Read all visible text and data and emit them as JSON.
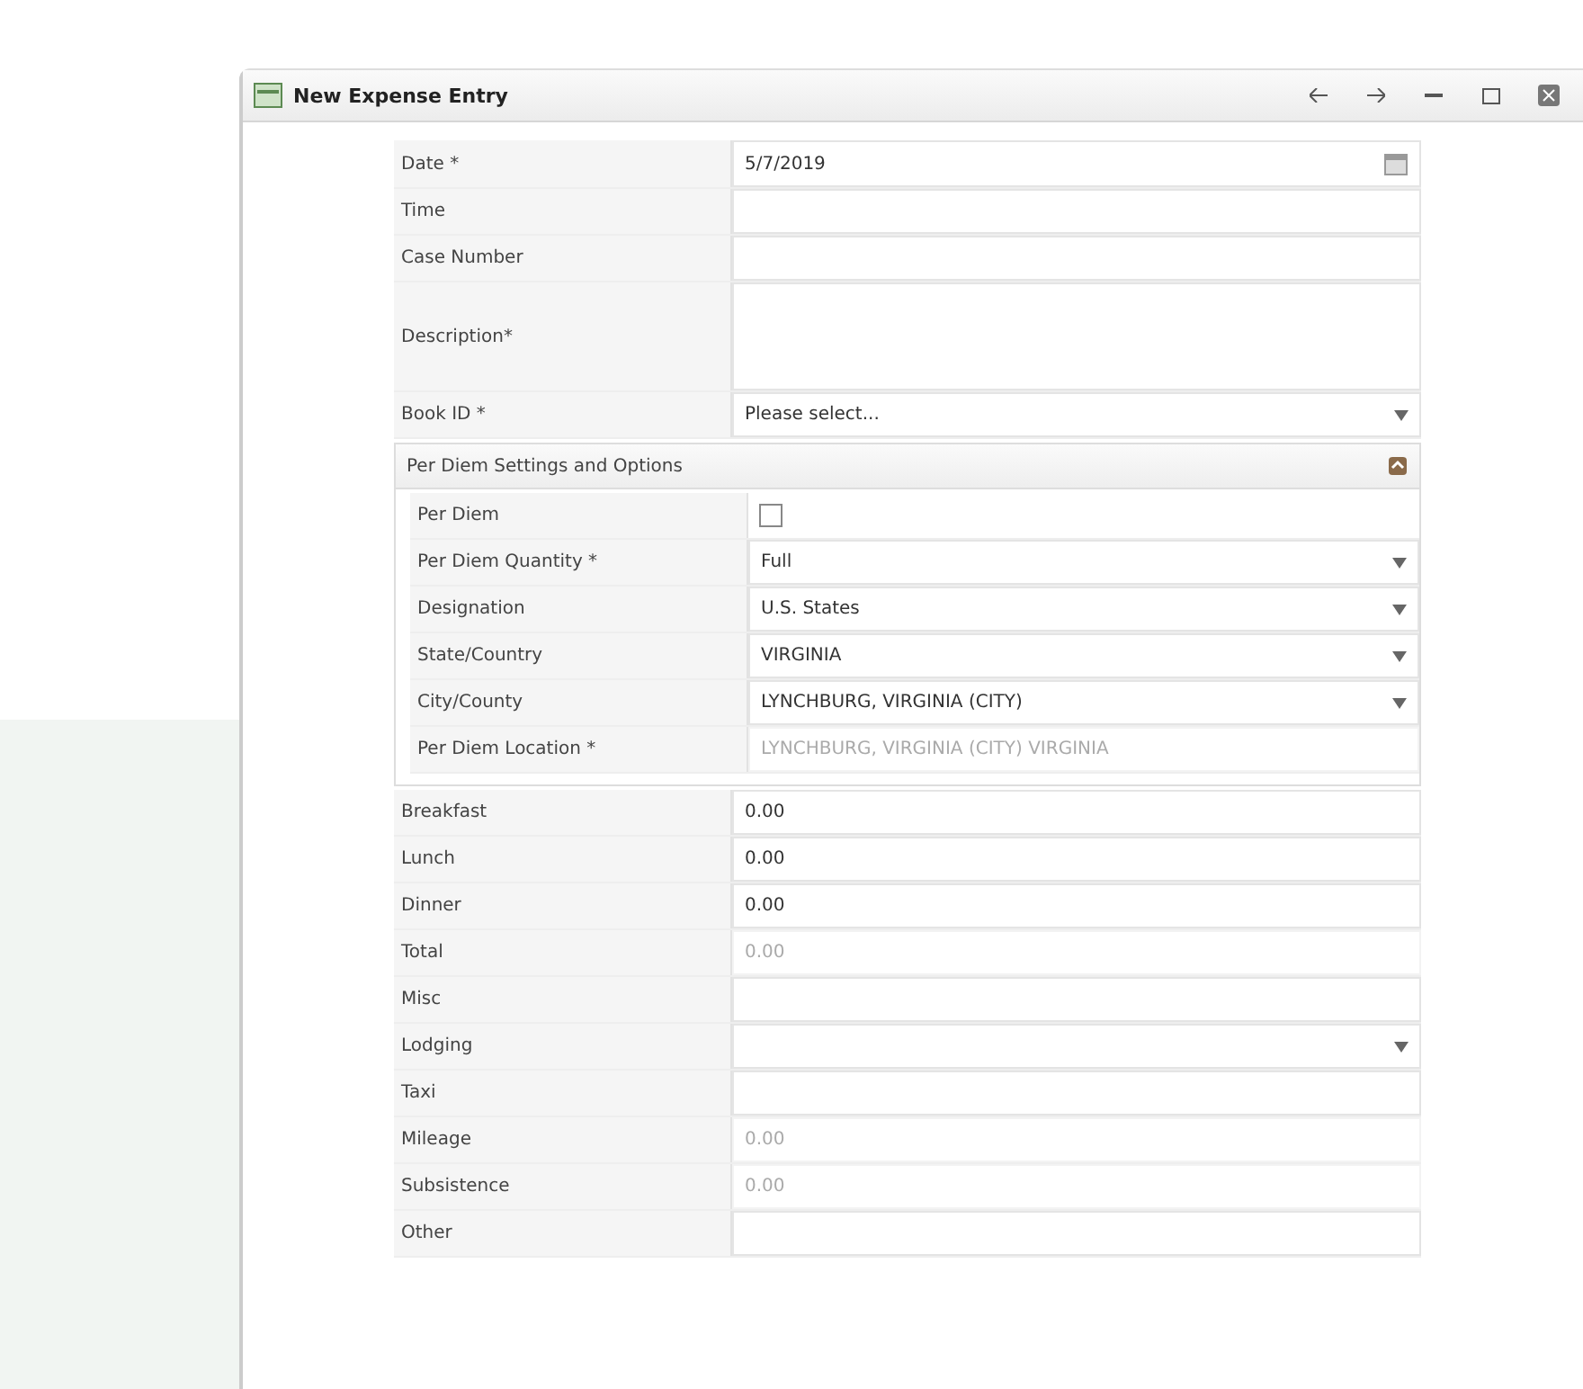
{
  "window": {
    "title": "New Expense Entry"
  },
  "fields": [
    {
      "kind": "date",
      "label": "Date *",
      "value": "5/7/2019"
    },
    {
      "kind": "text",
      "label": "Time"
    },
    {
      "kind": "text",
      "label": "Case Number"
    },
    {
      "kind": "textarea",
      "label": "Description*"
    },
    {
      "kind": "select",
      "label": "Book ID *",
      "value": "Please select..."
    },
    {
      "kind": "section",
      "label": "Per Diem Settings and Options",
      "children": [
        {
          "kind": "checkbox",
          "label": "Per Diem",
          "checked": false
        },
        {
          "kind": "select",
          "label": "Per Diem Quantity *",
          "value": "Full"
        },
        {
          "kind": "select",
          "label": "Designation",
          "value": "U.S. States"
        },
        {
          "kind": "select",
          "label": "State/Country",
          "value": "VIRGINIA"
        },
        {
          "kind": "select",
          "label": "City/County",
          "value": "LYNCHBURG, VIRGINIA (CITY)"
        },
        {
          "kind": "text",
          "label": "Per Diem Location *",
          "value": "LYNCHBURG, VIRGINIA (CITY) VIRGINIA",
          "disabled": true
        }
      ]
    },
    {
      "kind": "text",
      "label": "Breakfast",
      "value": "0.00",
      "disabled": false
    },
    {
      "kind": "text",
      "label": "Lunch",
      "value": "0.00",
      "disabled": false
    },
    {
      "kind": "text",
      "label": "Dinner",
      "value": "0.00",
      "disabled": false
    },
    {
      "kind": "text",
      "label": "Total",
      "value": "0.00",
      "disabled": true
    },
    {
      "kind": "text",
      "label": "Misc"
    },
    {
      "kind": "select",
      "label": "Lodging"
    },
    {
      "kind": "text",
      "label": "Taxi"
    },
    {
      "kind": "text",
      "label": "Mileage",
      "value": "0.00",
      "disabled": true
    },
    {
      "kind": "text",
      "label": "Subsistence",
      "value": "0.00",
      "disabled": true
    },
    {
      "kind": "text",
      "label": "Other"
    }
  ]
}
